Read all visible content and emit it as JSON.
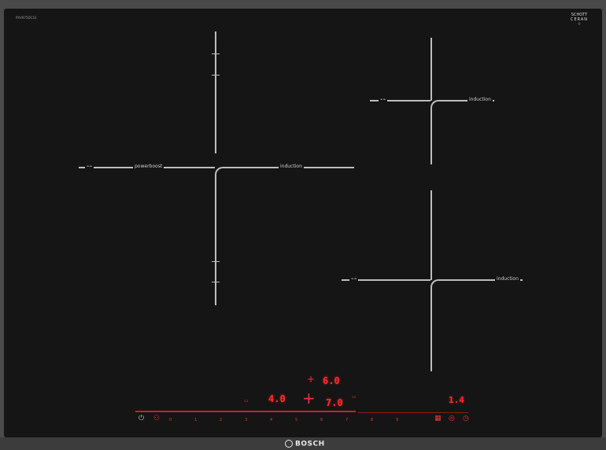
{
  "model_code": "PXV975DC1E",
  "brand_top": {
    "line1": "SCHOTT",
    "line2": "CERAN",
    "line3": "®"
  },
  "zones": {
    "left": {
      "left_label": "⌁⌁",
      "boost_label": "powerboost",
      "right_label": "induction"
    },
    "top_right": {
      "left_label": "⌁⌁",
      "right_label": "induction"
    },
    "bottom_right": {
      "left_label": "⌁⌁",
      "right_label": "induction"
    }
  },
  "control": {
    "display_top": "6.0",
    "display_left": "4.0",
    "display_center": "7.0",
    "display_timer": "1.4",
    "plus_symbol": "+",
    "power_icon": "power-icon",
    "scale": [
      "0",
      "1",
      "2",
      "3",
      "4",
      "5",
      "6",
      "7",
      "8",
      "9"
    ],
    "accent_color": "#ff2a2a"
  },
  "footer": {
    "brand": "BOSCH"
  }
}
